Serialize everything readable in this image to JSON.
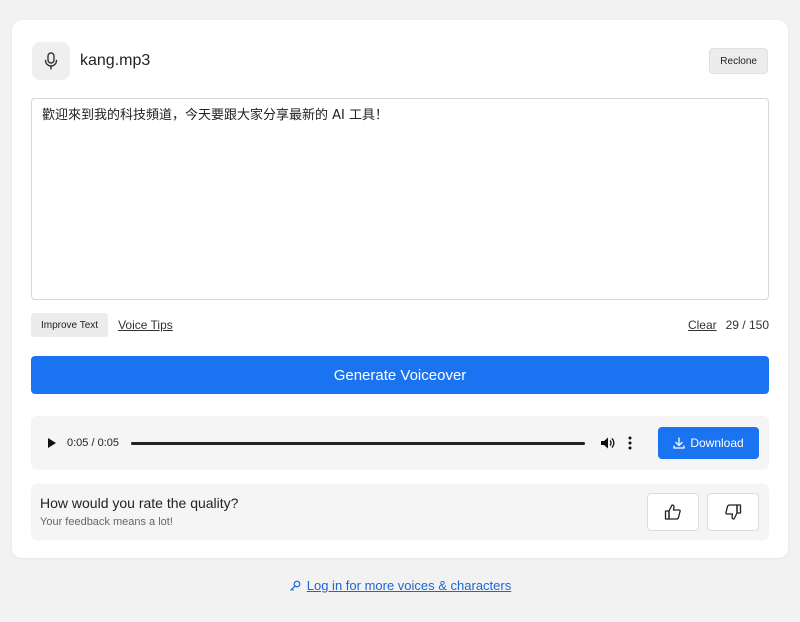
{
  "file": {
    "name": "kang.mp3",
    "mic_icon": "microphone-icon",
    "reclone_label": "Reclone"
  },
  "editor": {
    "text": "歡迎來到我的科技頻道，今天要跟大家分享最新的 AI 工具！"
  },
  "tools": {
    "improve_label": "Improve Text",
    "voice_tips_label": "Voice Tips",
    "clear_label": "Clear",
    "char_count": "29 / 150"
  },
  "generate": {
    "label": "Generate Voiceover"
  },
  "player": {
    "time": "0:05 / 0:05",
    "progress": 1.0,
    "download_label": "Download"
  },
  "rating": {
    "question": "How would you rate the quality?",
    "subtitle": "Your feedback means a lot!"
  },
  "footer": {
    "login_label": "Log in for more voices & characters",
    "icon": "key-icon"
  },
  "colors": {
    "accent": "#1a73f0",
    "link": "#1a66d6"
  }
}
